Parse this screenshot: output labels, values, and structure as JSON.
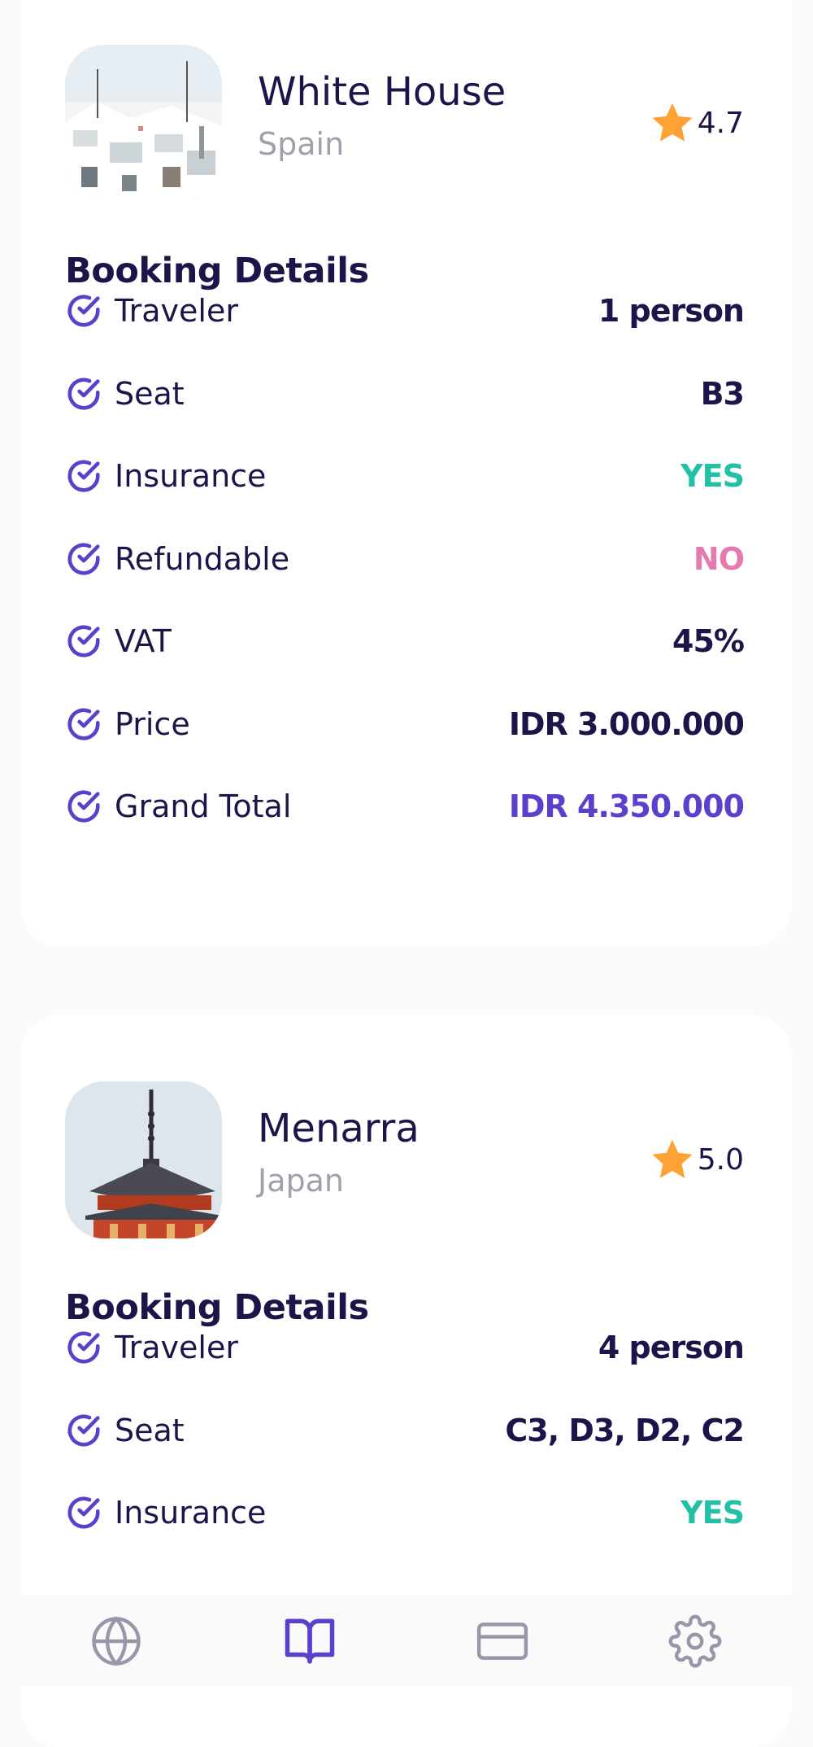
{
  "colors": {
    "primary": "#5C40CC",
    "dark_text": "#1F1449",
    "gray_text": "#A0A0AC",
    "yes": "#22C0A5",
    "no": "#E57AAE",
    "star": "#FFA235",
    "nav_inactive": "#9698A9"
  },
  "bookings": [
    {
      "destination": "White House",
      "country": "Spain",
      "rating": "4.7",
      "section_title": "Booking Details",
      "details": [
        {
          "label": "Traveler",
          "value": "1 person",
          "style": "normal"
        },
        {
          "label": "Seat",
          "value": "B3",
          "style": "normal"
        },
        {
          "label": "Insurance",
          "value": "YES",
          "style": "green"
        },
        {
          "label": "Refundable",
          "value": "NO",
          "style": "pink"
        },
        {
          "label": "VAT",
          "value": "45%",
          "style": "normal"
        },
        {
          "label": "Price",
          "value": "IDR 3.000.000",
          "style": "normal"
        },
        {
          "label": "Grand Total",
          "value": "IDR 4.350.000",
          "style": "purple"
        }
      ]
    },
    {
      "destination": "Menarra",
      "country": "Japan",
      "rating": "5.0",
      "section_title": "Booking Details",
      "details": [
        {
          "label": "Traveler",
          "value": "4 person",
          "style": "normal"
        },
        {
          "label": "Seat",
          "value": "C3, D3, D2, C2",
          "style": "normal"
        },
        {
          "label": "Insurance",
          "value": "YES",
          "style": "green"
        }
      ]
    }
  ],
  "bottom_nav": [
    {
      "icon": "globe-icon",
      "active": false
    },
    {
      "icon": "book-icon",
      "active": true
    },
    {
      "icon": "credit-card-icon",
      "active": false
    },
    {
      "icon": "gear-icon",
      "active": false
    }
  ]
}
